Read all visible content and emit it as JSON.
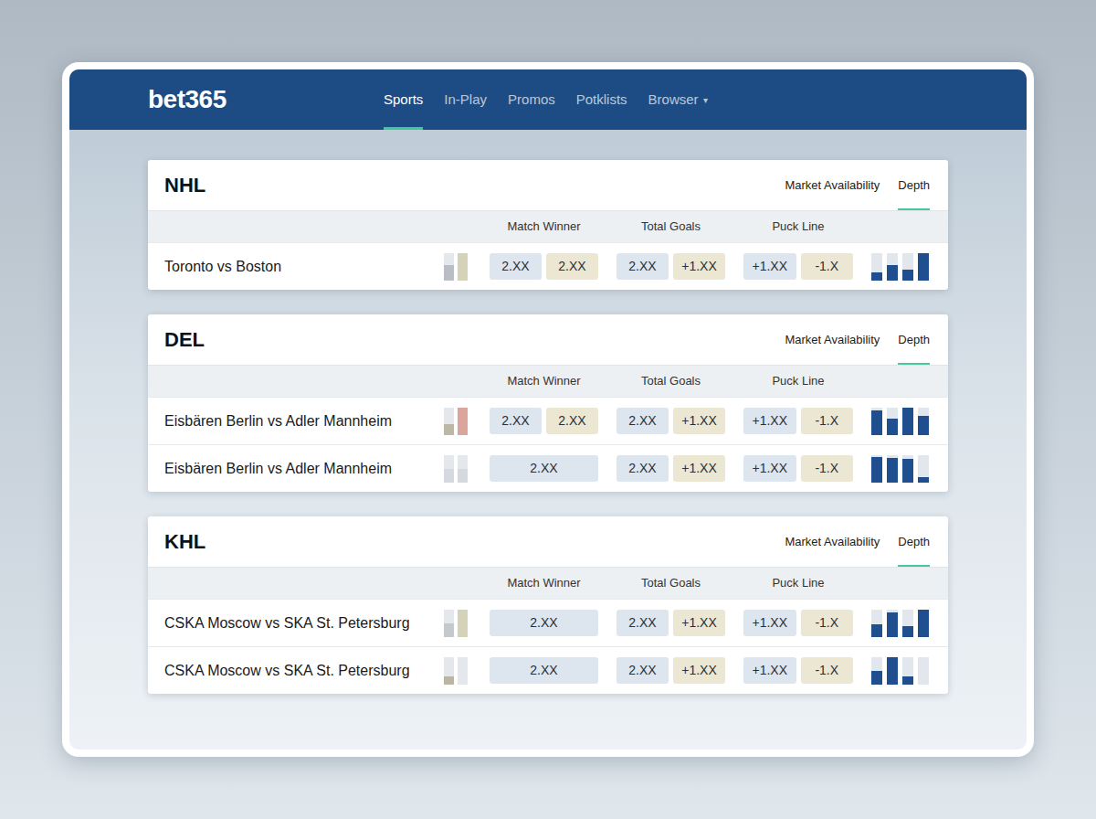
{
  "logo": "bet365",
  "nav": [
    {
      "label": "Sports",
      "selected": true
    },
    {
      "label": "In-Play",
      "selected": false
    },
    {
      "label": "Promos",
      "selected": false
    },
    {
      "label": "Potklists",
      "selected": false
    },
    {
      "label": "Browser",
      "selected": false,
      "caret": "▾"
    }
  ],
  "leagues": [
    {
      "title": "NHL",
      "tabs": [
        {
          "label": "Market Availability",
          "selected": false
        },
        {
          "label": "Depth",
          "selected": true
        }
      ],
      "columns": [
        "Match Winner",
        "Total Goals",
        "Puck Line"
      ],
      "rows": [
        {
          "match": "Toronto vs Boston",
          "indicator": [
            {
              "level": 0.55,
              "color": "#b8bec3"
            },
            {
              "level": 1,
              "color": "#d5d2ba"
            }
          ],
          "match_winner": [
            {
              "odds": "2.XX",
              "color": "#dde5ee"
            },
            {
              "odds": "2.XX",
              "color": "#ece7d3"
            }
          ],
          "total_goals": [
            {
              "odds": "2.XX",
              "color": "#dde5ee"
            },
            {
              "odds": "+1.XX",
              "color": "#ece7d3"
            }
          ],
          "puck_line": [
            {
              "odds": "+1.XX",
              "color": "#dde5ee"
            },
            {
              "odds": "-1.X",
              "color": "#ece7d3"
            }
          ],
          "depth": [
            0.3,
            0.55,
            0.38,
            1
          ]
        }
      ]
    },
    {
      "title": "DEL",
      "tabs": [
        {
          "label": "Market Availability",
          "selected": false
        },
        {
          "label": "Depth",
          "selected": true
        }
      ],
      "columns": [
        "Match Winner",
        "Total Goals",
        "Puck Line"
      ],
      "rows": [
        {
          "match": "Eisbären Berlin vs Adler Mannheim",
          "indicator": [
            {
              "level": 0.4,
              "color": "#bcb8a6"
            },
            {
              "level": 1,
              "color": "#dba49d"
            }
          ],
          "match_winner": [
            {
              "odds": "2.XX",
              "color": "#dde5ee"
            },
            {
              "odds": "2.XX",
              "color": "#ece7d3"
            }
          ],
          "total_goals": [
            {
              "odds": "2.XX",
              "color": "#dde5ee"
            },
            {
              "odds": "+1.XX",
              "color": "#ece7d3"
            }
          ],
          "puck_line": [
            {
              "odds": "+1.XX",
              "color": "#dde5ee"
            },
            {
              "odds": "-1.X",
              "color": "#ece7d3"
            }
          ],
          "depth": [
            0.9,
            0.6,
            1,
            0.7
          ]
        },
        {
          "match": "Eisbären Berlin vs Adler Mannheim",
          "indicator": [
            {
              "level": 0.5,
              "color": "#d3d9df"
            },
            {
              "level": 0.5,
              "color": "#d3d9df"
            }
          ],
          "match_winner": [
            {
              "odds": "2.XX",
              "color": "#dde5ee"
            }
          ],
          "total_goals": [
            {
              "odds": "2.XX",
              "color": "#dde5ee"
            },
            {
              "odds": "+1.XX",
              "color": "#ece7d3"
            }
          ],
          "puck_line": [
            {
              "odds": "+1.XX",
              "color": "#dde5ee"
            },
            {
              "odds": "-1.X",
              "color": "#ece7d3"
            }
          ],
          "depth": [
            0.92,
            0.9,
            0.85,
            0.2
          ]
        }
      ]
    },
    {
      "title": "KHL",
      "tabs": [
        {
          "label": "Market Availability",
          "selected": false
        },
        {
          "label": "Depth",
          "selected": true
        }
      ],
      "columns": [
        "Match Winner",
        "Total Goals",
        "Puck Line"
      ],
      "rows": [
        {
          "match": "CSKA Moscow vs SKA St. Petersburg",
          "indicator": [
            {
              "level": 0.5,
              "color": "#c4c9cd"
            },
            {
              "level": 1,
              "color": "#d5d2ba"
            }
          ],
          "match_winner": [
            {
              "odds": "2.XX",
              "color": "#dde5ee"
            }
          ],
          "total_goals": [
            {
              "odds": "2.XX",
              "color": "#dde5ee"
            },
            {
              "odds": "+1.XX",
              "color": "#ece7d3"
            }
          ],
          "puck_line": [
            {
              "odds": "+1.XX",
              "color": "#dde5ee"
            },
            {
              "odds": "-1.X",
              "color": "#ece7d3"
            }
          ],
          "depth": [
            0.45,
            0.9,
            0.4,
            1
          ]
        },
        {
          "match": "CSKA Moscow vs SKA St. Petersburg",
          "indicator": [
            {
              "level": 0.3,
              "color": "#b9b6a3"
            },
            {
              "level": 0,
              "color": "#d3d9df"
            }
          ],
          "match_winner": [
            {
              "odds": "2.XX",
              "color": "#dde5ee"
            }
          ],
          "total_goals": [
            {
              "odds": "2.XX",
              "color": "#dde5ee"
            },
            {
              "odds": "+1.XX",
              "color": "#ece7d3"
            }
          ],
          "puck_line": [
            {
              "odds": "+1.XX",
              "color": "#dde5ee"
            },
            {
              "odds": "-1.X",
              "color": "#ece7d3"
            }
          ],
          "depth": [
            0.5,
            1,
            0.3,
            0
          ]
        }
      ]
    }
  ]
}
